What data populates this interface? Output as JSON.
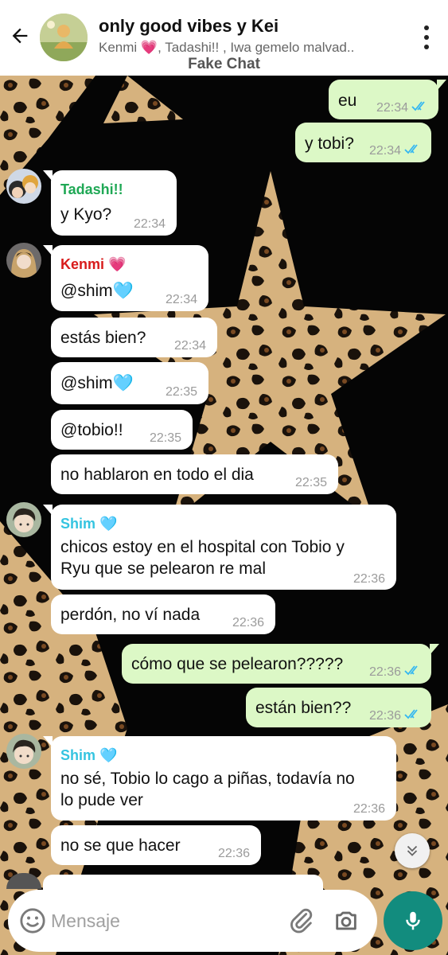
{
  "header": {
    "title": "only good vibes y Kei",
    "subtitle": "Kenmi 💗, Tadashi!! , Iwa gemelo malvad..",
    "watermark": "Fake Chat"
  },
  "colors": {
    "outgoing_bubble": "#dcf8c6",
    "incoming_bubble": "#ffffff",
    "accent": "#128c7e",
    "read_ticks": "#34b7f1",
    "tadashi": "#1fa855",
    "kenmi": "#d81b1b",
    "shim": "#35c4e0"
  },
  "messages": [
    {
      "text": "eu",
      "time": "22:34"
    },
    {
      "text": "y tobi?",
      "time": "22:34"
    },
    {
      "sender": "Tadashi!!",
      "text": "y Kyo?",
      "time": "22:34"
    },
    {
      "sender": "Kenmi 💗",
      "text": "@shim🩵",
      "time": "22:34"
    },
    {
      "text": "estás bien?",
      "time": "22:34"
    },
    {
      "text": "@shim🩵",
      "time": "22:35"
    },
    {
      "text": "@tobio!!",
      "time": "22:35"
    },
    {
      "text": "no hablaron en todo el dia",
      "time": "22:35"
    },
    {
      "sender": "Shim 🩵",
      "line1": "chicos estoy en el hospital con Tobio y",
      "line2": "Ryu que se pelearon re mal",
      "time": "22:36"
    },
    {
      "text": "perdón, no ví nada",
      "time": "22:36"
    },
    {
      "text": "cómo que se pelearon?????",
      "time": "22:36"
    },
    {
      "text": "están bien??",
      "time": "22:36"
    },
    {
      "sender": "Shim 🩵",
      "line1": "no sé, Tobio lo cago a piñas, todavía no",
      "line2": "lo pude ver",
      "time": "22:36"
    },
    {
      "text": "no se que hacer",
      "time": "22:36"
    }
  ],
  "icons": {
    "back": "arrow-left-icon",
    "menu": "more-vert-icon",
    "emoji": "emoji-icon",
    "attach": "paperclip-icon",
    "camera": "camera-icon",
    "mic": "mic-icon",
    "scroll": "chevron-double-down-icon"
  },
  "composer": {
    "placeholder": "Mensaje"
  }
}
